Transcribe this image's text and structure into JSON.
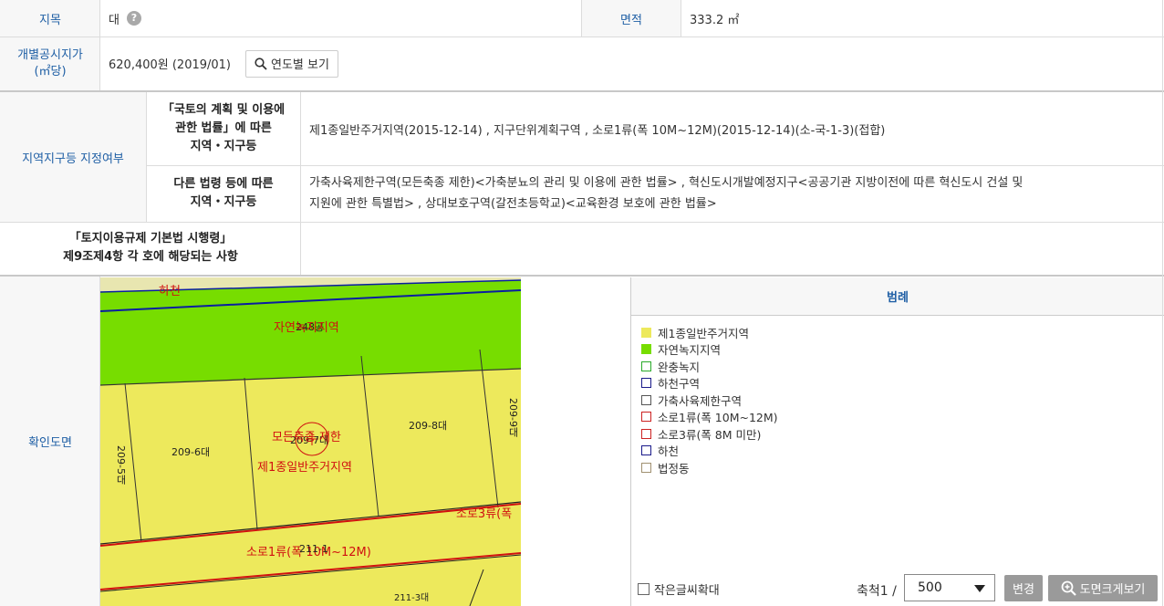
{
  "row1": {
    "jimok_label": "지목",
    "jimok_value": "대",
    "area_label": "면적",
    "area_value": "333.2 ㎡"
  },
  "row2": {
    "price_label_line1": "개별공시지가",
    "price_label_line2": "(㎡당)",
    "price_value": "620,400원 (2019/01)",
    "year_button": "연도별 보기"
  },
  "zoning": {
    "main_label": "지역지구등 지정여부",
    "sub1_line1": "「국토의 계획 및 이용에",
    "sub1_line2": "관한 법률」에 따른",
    "sub1_line3": "지역・지구등",
    "sub1_value": "제1종일반주거지역(2015-12-14) , 지구단위계획구역 , 소로1류(폭 10M~12M)(2015-12-14)(소-국-1-3)(접합)",
    "sub2_line1": "다른 법령 등에 따른",
    "sub2_line2": "지역・지구등",
    "sub2_value_line1": "가축사육제한구역(모든축종 제한)<가축분뇨의 관리 및 이용에 관한 법률> , 혁신도시개발예정지구<공공기관 지방이전에 따른 혁신도시 건설 및",
    "sub2_value_line2": "지원에 관한 특별법> , 상대보호구역(갈전초등학교)<교육환경 보호에 관한 법률>"
  },
  "article": {
    "line1": "「토지이용규제 기본법 시행령」",
    "line2": "제9조제4항 각 호에 해당되는 사항"
  },
  "map": {
    "row_label": "확인도면",
    "labels": {
      "river": "하천",
      "green_zone": "자연녹지지역",
      "parcel_top": "248공",
      "parcel_6": "209-6대",
      "parcel_7": "209-7대",
      "parcel_8": "209-8대",
      "parcel_9": "209-9대",
      "parcel_5": "209-5대",
      "restrict": "모든축종 제한",
      "residential": "제1종일반주거지역",
      "road3": "소로3류(폭",
      "road1": "소로1류(폭 10M~12M)",
      "road_num": "211-1",
      "parcel_bottom": "211-3대"
    },
    "colors": {
      "yellow": "#ede95c",
      "green": "#77dd00",
      "road": "#d01010",
      "river_line": "#0a1ea0"
    }
  },
  "legend": {
    "title": "범례",
    "items": [
      {
        "label": "제1종일반주거지역",
        "fill": "#ede95c",
        "border": "#ede95c"
      },
      {
        "label": "자연녹지지역",
        "fill": "#77dd00",
        "border": "#77dd00"
      },
      {
        "label": "완충녹지",
        "fill": "#ffffff",
        "border": "#2aaa2a"
      },
      {
        "label": "하천구역",
        "fill": "#ffffff",
        "border": "#1a1a8a"
      },
      {
        "label": "가축사육제한구역",
        "fill": "#ffffff",
        "border": "#555555"
      },
      {
        "label": "소로1류(폭 10M~12M)",
        "fill": "#ffffff",
        "border": "#cc2222"
      },
      {
        "label": "소로3류(폭 8M 미만)",
        "fill": "#ffffff",
        "border": "#cc2222"
      },
      {
        "label": "하천",
        "fill": "#ffffff",
        "border": "#1a1a8a"
      },
      {
        "label": "법정동",
        "fill": "#ffffff",
        "border": "#a09070"
      }
    ]
  },
  "controls": {
    "small_text_label": "작은글씨확대",
    "scale_label": "축척1 /",
    "scale_value": "500",
    "change_button": "변경",
    "enlarge_button": "도면크게보기"
  }
}
